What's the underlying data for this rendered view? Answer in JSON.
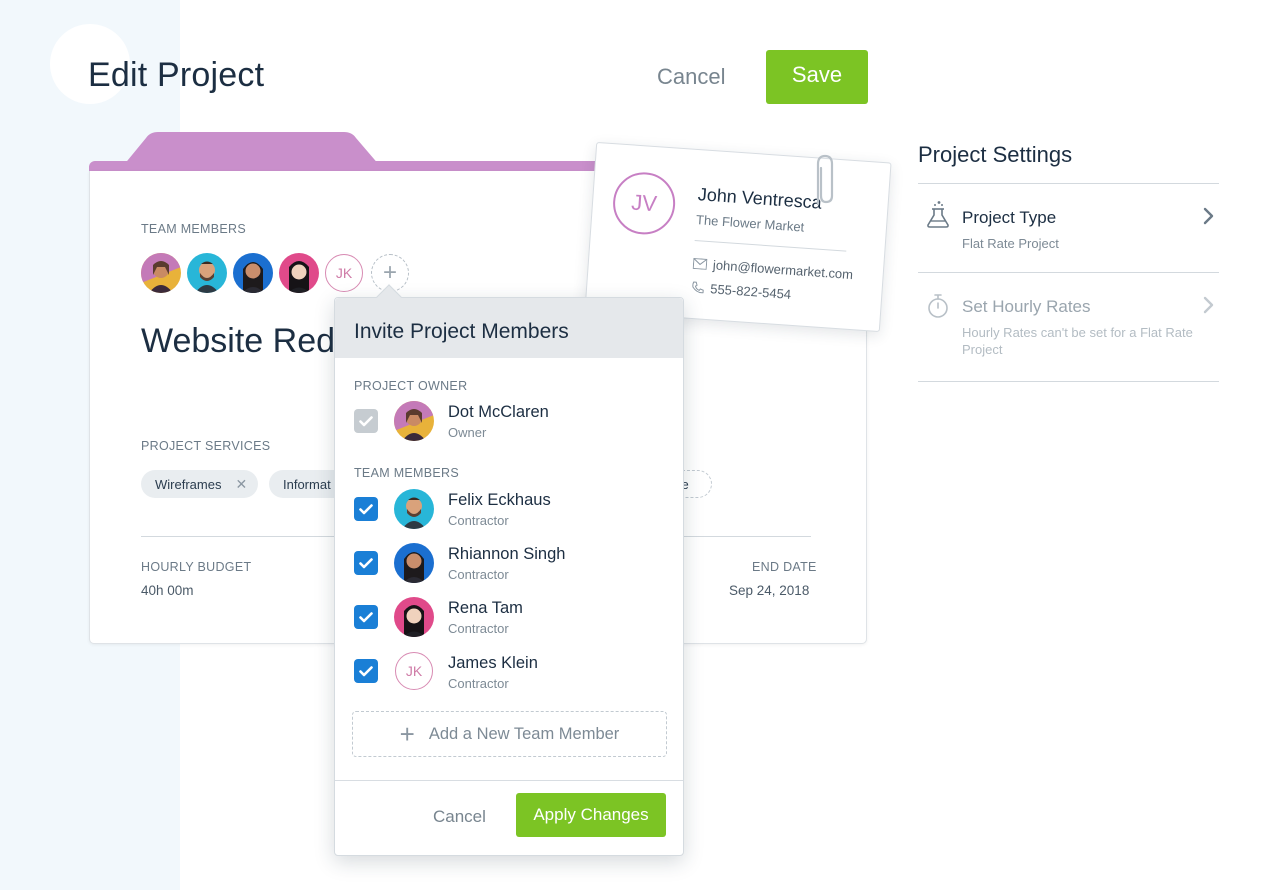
{
  "header": {
    "title": "Edit Project",
    "cancel_label": "Cancel",
    "save_label": "Save"
  },
  "project": {
    "team_members_label": "TEAM MEMBERS",
    "team_initials": "JK",
    "name": "Website Rede",
    "services_label": "PROJECT SERVICES",
    "services": [
      {
        "label": "Wireframes"
      },
      {
        "label": "Informat"
      },
      {
        "label": "ce"
      }
    ],
    "hourly_budget_label": "HOURLY BUDGET",
    "hourly_budget_value": "40h 00m",
    "end_date_label": "END DATE",
    "end_date_value": "Sep 24, 2018",
    "folder_color": "#c98fcb"
  },
  "contact": {
    "initials": "JV",
    "name": "John Ventresca",
    "company": "The Flower Market",
    "email": "john@flowermarket.com",
    "phone": "555-822-5454"
  },
  "invite": {
    "title": "Invite Project Members",
    "owner_label": "PROJECT OWNER",
    "owner": {
      "name": "Dot McClaren",
      "role": "Owner",
      "checked": true,
      "disabled": true
    },
    "members_label": "TEAM MEMBERS",
    "members": [
      {
        "name": "Felix Eckhaus",
        "role": "Contractor",
        "checked": true
      },
      {
        "name": "Rhiannon Singh",
        "role": "Contractor",
        "checked": true
      },
      {
        "name": "Rena Tam",
        "role": "Contractor",
        "checked": true
      },
      {
        "name": "James Klein",
        "role": "Contractor",
        "checked": true,
        "initials": "JK"
      }
    ],
    "add_label": "Add a New Team Member",
    "cancel_label": "Cancel",
    "apply_label": "Apply Changes"
  },
  "settings": {
    "title": "Project Settings",
    "items": [
      {
        "title": "Project Type",
        "subtitle": "Flat Rate Project",
        "icon": "flask-icon",
        "enabled": true
      },
      {
        "title": "Set Hourly Rates",
        "subtitle": "Hourly Rates can't be set for a Flat Rate Project",
        "icon": "stopwatch-icon",
        "enabled": false
      }
    ]
  },
  "colors": {
    "accent_green": "#7cc424",
    "checkbox_blue": "#1a7fd6",
    "contact_purple": "#c77fc4"
  }
}
